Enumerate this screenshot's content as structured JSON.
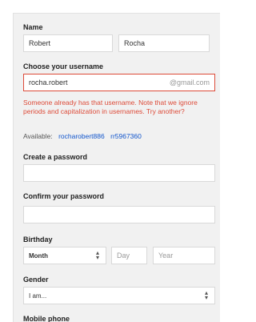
{
  "form": {
    "name_label": "Name",
    "first_name": "Robert",
    "last_name": "Rocha",
    "username_label": "Choose your username",
    "username_value": "rocha.robert",
    "username_suffix": "@gmail.com",
    "username_error": "Someone already has that username. Note that we ignore periods and capitalization in usernames. Try another?",
    "available_label": "Available:",
    "suggestions": [
      "rocharobert886",
      "rr5967360"
    ],
    "password_label": "Create a password",
    "password_value": "",
    "confirm_label": "Confirm your password",
    "confirm_value": "",
    "birthday_label": "Birthday",
    "month_value": "Month",
    "day_placeholder": "Day",
    "year_placeholder": "Year",
    "gender_label": "Gender",
    "gender_value": "I am...",
    "mobile_label": "Mobile phone"
  },
  "colors": {
    "error": "#dd4b39",
    "link": "#1155cc",
    "background": "#f1f1f1"
  },
  "icons": {
    "select_arrow": "up-down-arrow-icon"
  }
}
